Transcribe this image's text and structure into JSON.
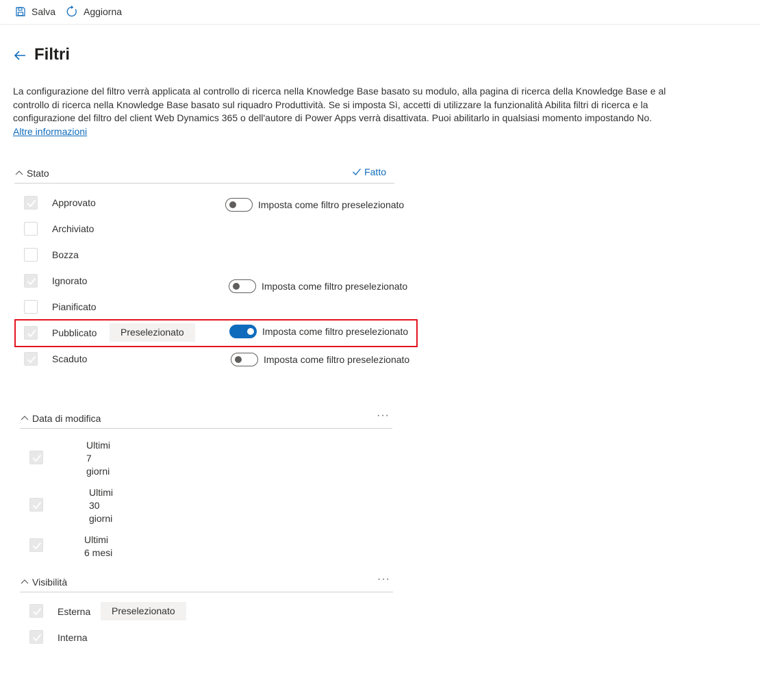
{
  "toolbar": {
    "save_label": "Salva",
    "refresh_label": "Aggiorna"
  },
  "page": {
    "title": "Filtri",
    "description": "La configurazione del filtro verrà applicata al controllo di ricerca nella Knowledge Base basato su modulo, alla pagina di ricerca della Knowledge Base e al controllo di ricerca nella Knowledge Base basato sul riquadro Produttività. Se si imposta Sì, accetti di utilizzare la funzionalità Abilita filtri di ricerca e la configurazione del filtro del client Web Dynamics 365 o dell'autore di Power Apps verrà disattivata. Puoi abilitarlo in qualsiasi momento impostando No.",
    "learn_more": "Altre informazioni"
  },
  "stato": {
    "header": "Stato",
    "done_label": "Fatto",
    "toggle_label": "Imposta come filtro preselezionato",
    "preselected_tag": "Preselezionato",
    "items": [
      {
        "label": "Approvato",
        "checked": true,
        "has_toggle": true,
        "toggle_on": false
      },
      {
        "label": "Archiviato",
        "checked": false,
        "has_toggle": false
      },
      {
        "label": "Bozza",
        "checked": false,
        "has_toggle": false
      },
      {
        "label": "Ignorato",
        "checked": true,
        "has_toggle": true,
        "toggle_on": false
      },
      {
        "label": "Pianificato",
        "checked": false,
        "has_toggle": false
      },
      {
        "label": "Pubblicato",
        "checked": true,
        "has_toggle": true,
        "toggle_on": true,
        "preselected": true
      },
      {
        "label": "Scaduto",
        "checked": true,
        "has_toggle": true,
        "toggle_on": false
      }
    ]
  },
  "data_modifica": {
    "header": "Data di modifica",
    "more": "···",
    "items": [
      {
        "lines": [
          "Ultimi",
          "7",
          "giorni"
        ],
        "checked": true
      },
      {
        "lines": [
          "Ultimi",
          "30",
          "giorni"
        ],
        "checked": true
      },
      {
        "lines": [
          "Ultimi",
          "6 mesi"
        ],
        "checked": true
      }
    ]
  },
  "visibilita": {
    "header": "Visibilità",
    "more": "···",
    "preselected_tag": "Preselezionato",
    "items": [
      {
        "label": "Esterna",
        "checked": true,
        "preselected": true
      },
      {
        "label": "Interna",
        "checked": true
      }
    ]
  },
  "colors": {
    "accent": "#0f6cbd",
    "highlight": "#e3131d"
  }
}
